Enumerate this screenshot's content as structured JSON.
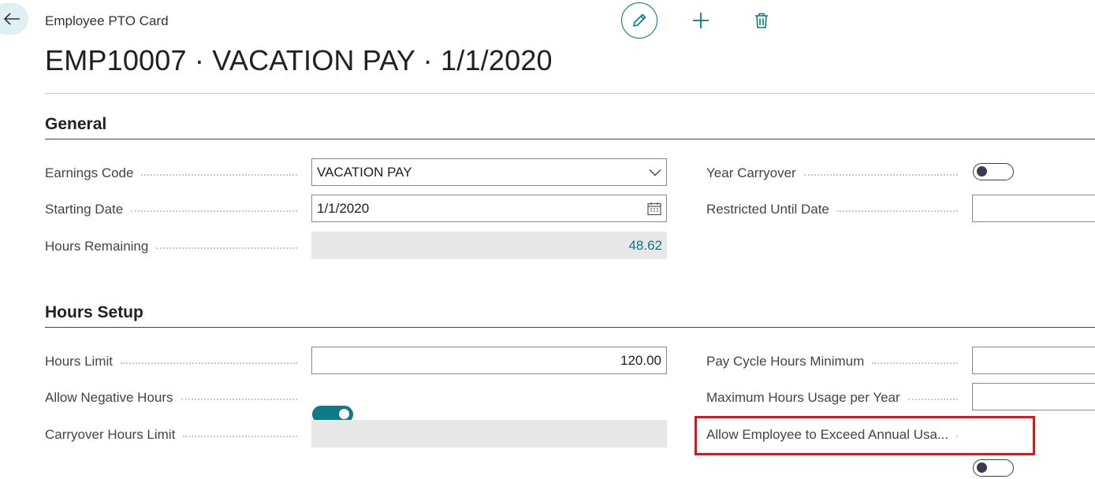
{
  "header": {
    "caption": "Employee PTO Card",
    "title": "EMP10007 · VACATION PAY · 1/1/2020",
    "icons": [
      "back-arrow-icon",
      "pencil-icon",
      "plus-icon",
      "trash-icon"
    ]
  },
  "colors": {
    "accent": "#0b7c83",
    "highlight": "#e0141e",
    "readonly_bg": "#e8e8e8"
  },
  "general": {
    "title": "General",
    "earnings_code": {
      "label": "Earnings Code",
      "value": "VACATION PAY"
    },
    "starting_date": {
      "label": "Starting Date",
      "value": "1/1/2020"
    },
    "hours_remaining": {
      "label": "Hours Remaining",
      "value": "48.62"
    },
    "year_carryover": {
      "label": "Year Carryover",
      "checked": false
    },
    "restricted_until_date": {
      "label": "Restricted Until Date",
      "value": ""
    }
  },
  "hours_setup": {
    "title": "Hours Setup",
    "hours_limit": {
      "label": "Hours Limit",
      "value": "120.00"
    },
    "allow_negative_hours": {
      "label": "Allow Negative Hours",
      "checked": true
    },
    "carryover_hours_limit": {
      "label": "Carryover Hours Limit",
      "value": ""
    },
    "pay_cycle_hours_minimum": {
      "label": "Pay Cycle Hours Minimum",
      "value": ""
    },
    "max_hours_usage_per_year": {
      "label": "Maximum Hours Usage per Year",
      "value": ""
    },
    "allow_exceed_annual_usage": {
      "label": "Allow Employee to Exceed Annual Usa...",
      "checked": false
    }
  }
}
